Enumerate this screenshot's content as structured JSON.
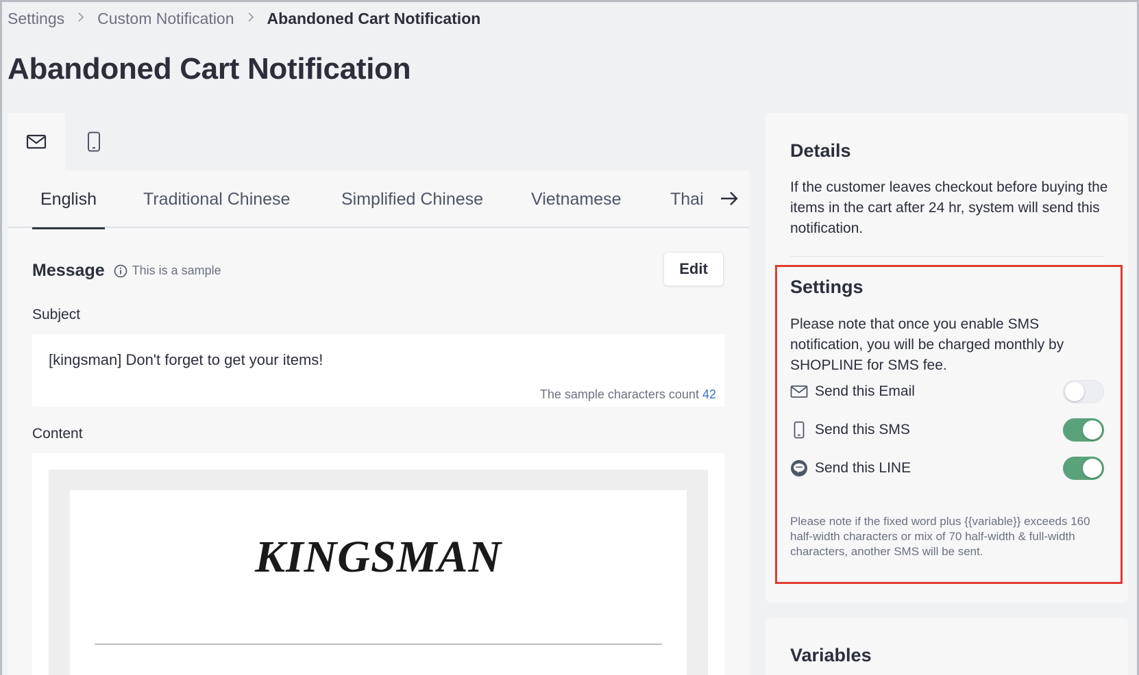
{
  "breadcrumb": {
    "items": [
      "Settings",
      "Custom Notification"
    ],
    "current": "Abandoned Cart Notification"
  },
  "page": {
    "title": "Abandoned Cart Notification"
  },
  "channel_tabs": [
    {
      "icon": "mail-icon",
      "active": true
    },
    {
      "icon": "mobile-icon",
      "active": false
    }
  ],
  "language_tabs": [
    "English",
    "Traditional Chinese",
    "Simplified Chinese",
    "Vietnamese",
    "Thai"
  ],
  "active_language": "English",
  "message": {
    "title": "Message",
    "sample_note": "This is a sample",
    "edit_label": "Edit",
    "subject_label": "Subject",
    "subject_value": "[kingsman] Don't forget to get your items!",
    "char_count_label": "The sample characters count",
    "char_count": "42",
    "content_label": "Content",
    "brand_logo": "KINGSMAN"
  },
  "details": {
    "title": "Details",
    "text": "If the customer leaves checkout before buying the items in the cart after 24 hr, system will send this notification."
  },
  "settings": {
    "title": "Settings",
    "note": "Please note that once you enable SMS notification, you will be charged monthly by SHOPLINE for SMS fee.",
    "toggles": [
      {
        "label": "Send this Email",
        "icon": "mail-icon",
        "enabled": false
      },
      {
        "label": "Send this SMS",
        "icon": "mobile-icon",
        "enabled": true
      },
      {
        "label": "Send this LINE",
        "icon": "line-icon",
        "enabled": true
      }
    ],
    "sms_note": "Please note if the fixed word plus {{variable}} exceeds 160 half-width characters or mix of 70 half-width & full-width characters, another SMS will be sent."
  },
  "variables": {
    "title": "Variables"
  },
  "colors": {
    "toggle_on": "#5aa27a",
    "highlight": "#e13b2f",
    "count_accent": "#3b72c4"
  }
}
